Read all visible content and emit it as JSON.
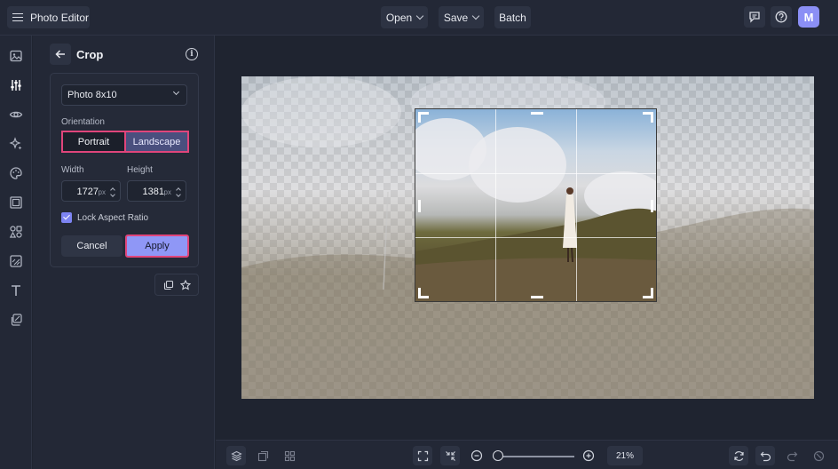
{
  "app": {
    "title": "Photo Editor",
    "avatar_initial": "M"
  },
  "topbar": {
    "open_label": "Open",
    "save_label": "Save",
    "batch_label": "Batch"
  },
  "rail": {
    "items": [
      "image-icon",
      "adjust-sliders-icon",
      "eye-icon",
      "effects-sparkle-icon",
      "palette-icon",
      "frame-icon",
      "shapes-icon",
      "texture-icon",
      "text-icon",
      "layers-icon"
    ],
    "active_index": 1
  },
  "crop_panel": {
    "title": "Crop",
    "preset": "Photo 8x10",
    "orientation_label": "Orientation",
    "orientation_options": [
      "Portrait",
      "Landscape"
    ],
    "orientation_selected": "Landscape",
    "width_label": "Width",
    "height_label": "Height",
    "width_value": "1727",
    "height_value": "1381",
    "unit": "px",
    "lock_label": "Lock Aspect Ratio",
    "lock_checked": true,
    "cancel_label": "Cancel",
    "apply_label": "Apply"
  },
  "bottombar": {
    "zoom_label": "21%",
    "zoom_fraction": 0.0
  },
  "colors": {
    "accent": "#8f97f6",
    "highlight": "#e0457b",
    "background": "#1f2430"
  }
}
